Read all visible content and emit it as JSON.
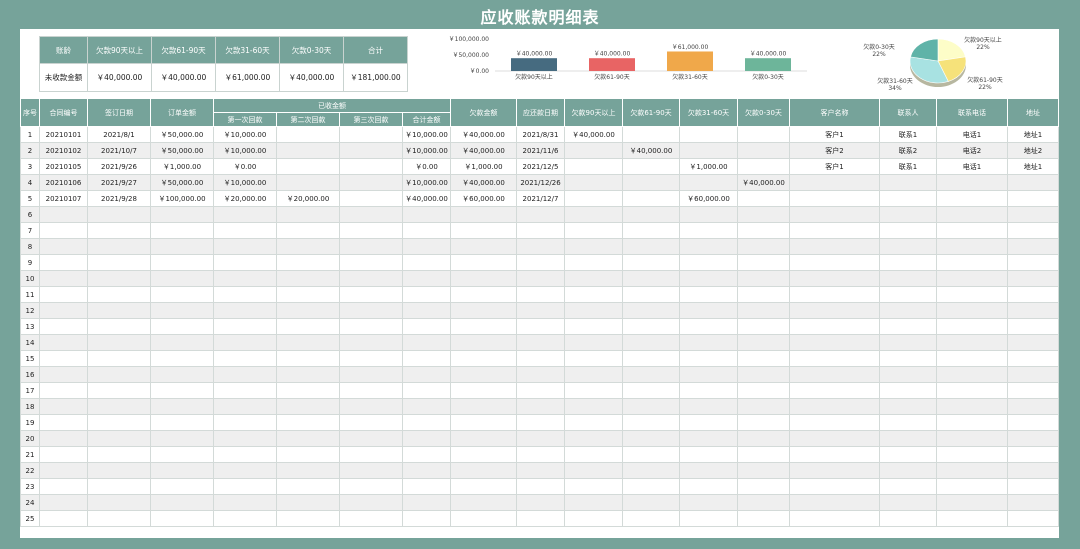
{
  "title": "应收账款明细表",
  "summary": {
    "headers": [
      "账龄",
      "欠款90天以上",
      "欠款61-90天",
      "欠款31-60天",
      "欠款0-30天",
      "合计"
    ],
    "row": [
      "未收款金额",
      "￥40,000.00",
      "￥40,000.00",
      "￥61,000.00",
      "￥40,000.00",
      "￥181,000.00"
    ]
  },
  "chart_data": [
    {
      "type": "bar",
      "categories": [
        "欠款90天以上",
        "欠款61-90天",
        "欠款31-60天",
        "欠款0-30天"
      ],
      "values": [
        40000,
        40000,
        61000,
        40000
      ],
      "data_labels": [
        "￥40,000.00",
        "￥40,000.00",
        "￥61,000.00",
        "￥40,000.00"
      ],
      "y_ticks": [
        "￥100,000.00",
        "￥50,000.00",
        "￥0.00"
      ],
      "ylim": [
        0,
        100000
      ],
      "colors": [
        "#466b80",
        "#e86464",
        "#f0a84a",
        "#6db59a"
      ],
      "grid": false
    },
    {
      "type": "pie",
      "labels": [
        "欠款90天以上",
        "欠款61-90天",
        "欠款31-60天",
        "欠款0-30天"
      ],
      "values": [
        22,
        22,
        34,
        22
      ],
      "percent_labels": [
        "22%",
        "22%",
        "34%",
        "22%"
      ],
      "colors": [
        "#fdfdc8",
        "#f6e27a",
        "#a8e2e2",
        "#5fb3a8"
      ]
    }
  ],
  "table": {
    "headers_row1": [
      "序号",
      "合同编号",
      "签订日期",
      "订单金额",
      "已收金额",
      "欠款金额",
      "应还款日期",
      "欠款90天以上",
      "欠款61-90天",
      "欠款31-60天",
      "欠款0-30天",
      "客户名称",
      "联系人",
      "联系电话",
      "地址"
    ],
    "headers_row2": [
      "第一次回款",
      "第二次回款",
      "第三次回款",
      "合计金额"
    ],
    "rows": [
      [
        "1",
        "20210101",
        "2021/8/1",
        "￥50,000.00",
        "￥10,000.00",
        "",
        "",
        "￥10,000.00",
        "￥40,000.00",
        "2021/8/31",
        "￥40,000.00",
        "",
        "",
        "",
        "客户1",
        "联系1",
        "电话1",
        "地址1"
      ],
      [
        "2",
        "20210102",
        "2021/10/7",
        "￥50,000.00",
        "￥10,000.00",
        "",
        "",
        "￥10,000.00",
        "￥40,000.00",
        "2021/11/6",
        "",
        "￥40,000.00",
        "",
        "",
        "客户2",
        "联系2",
        "电话2",
        "地址2"
      ],
      [
        "3",
        "20210105",
        "2021/9/26",
        "￥1,000.00",
        "￥0.00",
        "",
        "",
        "￥0.00",
        "￥1,000.00",
        "2021/12/5",
        "",
        "",
        "￥1,000.00",
        "",
        "客户1",
        "联系1",
        "电话1",
        "地址1"
      ],
      [
        "4",
        "20210106",
        "2021/9/27",
        "￥50,000.00",
        "￥10,000.00",
        "",
        "",
        "￥10,000.00",
        "￥40,000.00",
        "2021/12/26",
        "",
        "",
        "",
        "￥40,000.00",
        "",
        "",
        "",
        ""
      ],
      [
        "5",
        "20210107",
        "2021/9/28",
        "￥100,000.00",
        "￥20,000.00",
        "￥20,000.00",
        "",
        "￥40,000.00",
        "￥60,000.00",
        "2021/12/7",
        "",
        "",
        "￥60,000.00",
        "",
        "",
        "",
        "",
        ""
      ]
    ],
    "empty_row_numbers": [
      "6",
      "7",
      "8",
      "9",
      "10",
      "11",
      "12",
      "13",
      "14",
      "15",
      "16",
      "17",
      "18",
      "19",
      "20",
      "21",
      "22",
      "23",
      "24",
      "25"
    ]
  }
}
